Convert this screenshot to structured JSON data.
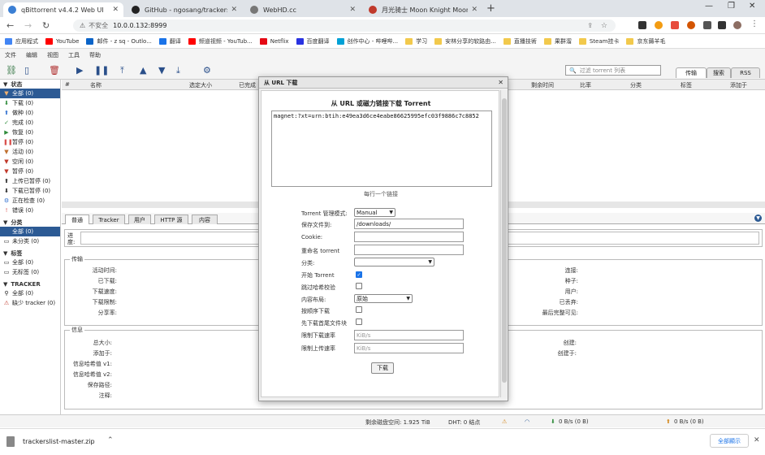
{
  "browser": {
    "tabs": [
      {
        "label": "qBittorrent v4.4.2 Web UI",
        "icon": "qbittorrent-icon",
        "color": "#3b7fd4"
      },
      {
        "label": "GitHub - ngosang/trackerslist",
        "icon": "github-icon",
        "color": "#222222"
      },
      {
        "label": "WebHD.cc",
        "icon": "globe-icon",
        "color": "#555555"
      },
      {
        "label": "月光骑士 Moon Knight Moon...",
        "icon": "site-icon",
        "color": "#c0392b"
      }
    ],
    "address": {
      "warning": "不安全",
      "url": "10.0.0.132:8999"
    },
    "bookmarks": [
      {
        "label": "应用程式",
        "color": "#4285f4"
      },
      {
        "label": "YouTube",
        "color": "#ff0000"
      },
      {
        "label": "邮件 - z sq - Outlo...",
        "color": "#0a64c8"
      },
      {
        "label": "翻译",
        "color": "#1a73e8"
      },
      {
        "label": "频道视频 - YouTub...",
        "color": "#ff0000"
      },
      {
        "label": "Netflix",
        "color": "#e50914"
      },
      {
        "label": "百度翻译",
        "color": "#2932e1"
      },
      {
        "label": "创作中心 - 哔哩哔...",
        "color": "#00a1d6"
      },
      {
        "label": "学习",
        "color": "#f2c94c"
      },
      {
        "label": "安林分享的软路由...",
        "color": "#f2c94c"
      },
      {
        "label": "直播技術",
        "color": "#f2c94c"
      },
      {
        "label": "果群溜",
        "color": "#f2c94c"
      },
      {
        "label": "Steam挂卡",
        "color": "#f2c94c"
      },
      {
        "label": "京东薅羊毛",
        "color": "#f2c94c"
      }
    ]
  },
  "app": {
    "menu": [
      "文件",
      "编辑",
      "视图",
      "工具",
      "帮助"
    ],
    "filter_placeholder": "过滤 torrent 列表",
    "right_tabs": [
      "传输",
      "搜索",
      "RSS"
    ],
    "columns": [
      "#",
      "名称",
      "选定大小",
      "已完成",
      "剩余时间",
      "比率",
      "分类",
      "标签",
      "添加于"
    ],
    "sidebar": {
      "status_header": "状态",
      "status_items": [
        {
          "label": "全部 (0)",
          "icon": "filter-icon",
          "color": "#c07030"
        },
        {
          "label": "下载 (0)",
          "icon": "download-arrow-icon",
          "color": "#2e8b3a"
        },
        {
          "label": "做种 (0)",
          "icon": "upload-arrow-icon",
          "color": "#2f6fcf"
        },
        {
          "label": "完成 (0)",
          "icon": "check-icon",
          "color": "#2e8b3a"
        },
        {
          "label": "恢复 (0)",
          "icon": "play-icon",
          "color": "#2e8b3a"
        },
        {
          "label": "暂停 (0)",
          "icon": "pause-icon",
          "color": "#d9534f"
        },
        {
          "label": "活动 (0)",
          "icon": "filter-icon",
          "color": "#c07030"
        },
        {
          "label": "空闲 (0)",
          "icon": "filter-icon",
          "color": "#c0392b"
        },
        {
          "label": "暂停 (0)",
          "icon": "filter-icon",
          "color": "#c0392b"
        },
        {
          "label": "上传已暂停 (0)",
          "icon": "upload-arrow-icon",
          "color": "#222222"
        },
        {
          "label": "下载已暂停 (0)",
          "icon": "download-arrow-icon",
          "color": "#222222"
        },
        {
          "label": "正在检查 (0)",
          "icon": "gear-icon",
          "color": "#2f6fcf"
        },
        {
          "label": "错误 (0)",
          "icon": "error-icon",
          "color": "#d9534f"
        }
      ],
      "category_header": "分类",
      "category_items": [
        "全部 (0)",
        "未分类 (0)"
      ],
      "tag_header": "标签",
      "tag_items": [
        "全部 (0)",
        "无标签 (0)"
      ],
      "tracker_header": "TRACKER",
      "tracker_items": [
        "全部 (0)",
        "缺少 tracker (0)"
      ]
    },
    "properties_tabs": [
      "普通",
      "Tracker",
      "用户",
      "HTTP 源",
      "内容"
    ],
    "progress_label": "进度:",
    "transfer": {
      "title": "传输",
      "left_labels": [
        "活动时间:",
        "已下载:",
        "下载速度:",
        "下载限制:",
        "分享率:"
      ],
      "right_labels": [
        "连接:",
        "种子:",
        "用户:",
        "已丢弃:",
        "最后完整可见:"
      ]
    },
    "info": {
      "title": "信息",
      "left_labels": [
        "总大小:",
        "添加于:",
        "信息哈希值 v1:",
        "信息哈希值 v2:",
        "保存路径:",
        "注释:"
      ],
      "right_labels": [
        "创建:",
        "创建于:"
      ]
    },
    "statusbar": {
      "free_space": "剩余磁盘空间: 1.925 TiB",
      "dht": "DHT: 0 结点",
      "download": "0 B/s (0 B)",
      "upload": "0 B/s (0 B)"
    }
  },
  "dialog": {
    "title": "从 URL 下载",
    "heading": "从 URL 或磁力链接下载 Torrent",
    "magnet": "magnet:?xt=urn:btih:e49ea3d6ce4eabe86625995efc03f9886c7c8852",
    "hint": "每行一个链接",
    "fields": {
      "mode_label": "Torrent 管理模式:",
      "mode_value": "Manual",
      "save_label": "保存文件到:",
      "save_value": "/downloads/",
      "cookie_label": "Cookie:",
      "rename_label": "重命名 torrent",
      "category_label": "分类:",
      "start_label": "开始 Torrent",
      "start_checked": true,
      "skip_check_label": "跳过哈希校验",
      "skip_check_checked": false,
      "layout_label": "内容布局:",
      "layout_value": "原始",
      "sequential_label": "按顺序下载",
      "sequential_checked": false,
      "firstlast_label": "先下载首尾文件块",
      "firstlast_checked": false,
      "dl_limit_label": "限制下载速率",
      "dl_limit_placeholder": "KiB/s",
      "ul_limit_label": "限制上传速率",
      "ul_limit_placeholder": "KiB/s"
    },
    "download_button": "下载"
  },
  "download_shelf": {
    "file": "trackerslist-master.zip",
    "show_all": "全部顯示"
  }
}
